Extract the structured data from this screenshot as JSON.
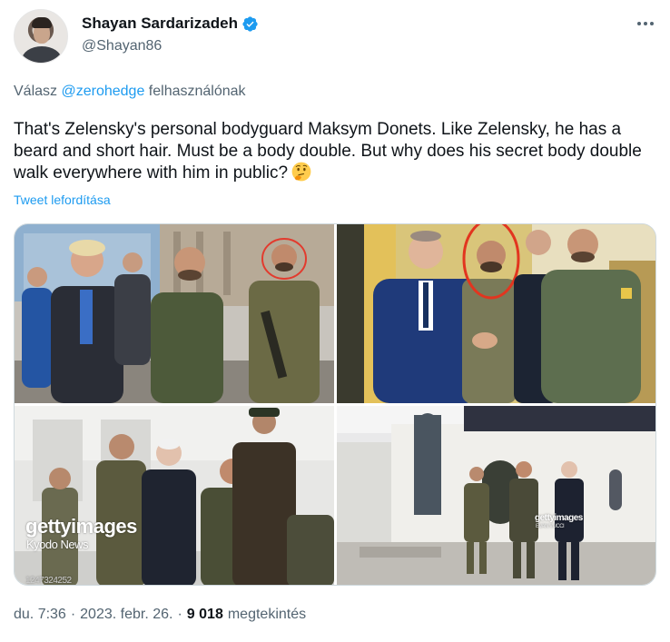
{
  "author": {
    "display_name": "Shayan Sardarizadeh",
    "handle": "@Shayan86",
    "verified": true
  },
  "reply": {
    "prefix": "Válasz",
    "mention": "@zerohedge",
    "suffix": "felhasználónak"
  },
  "tweet": {
    "text": "That's Zelensky's personal bodyguard Maksym Donets. Like Zelensky, he has a beard and short hair. Must be a body double. But why does his secret body double walk everywhere with him in public?",
    "emoji": "thinking-face-icon",
    "translate_label": "Tweet lefordítása"
  },
  "media": {
    "watermark_brand": "gettyimages",
    "watermark_credit": "Kyodo News",
    "image_id": "1247324252",
    "watermark_small_brand": "gettyimages",
    "watermark_small_credit": "EVAN VUCCI"
  },
  "meta": {
    "time": "du. 7:36",
    "sep1": "·",
    "date": "2023. febr. 26.",
    "sep2": "·",
    "views_count": "9 018",
    "views_label": "megtekintés"
  },
  "colors": {
    "accent": "#1d9bf0",
    "secondary_text": "#536471",
    "primary_text": "#0f1419"
  }
}
